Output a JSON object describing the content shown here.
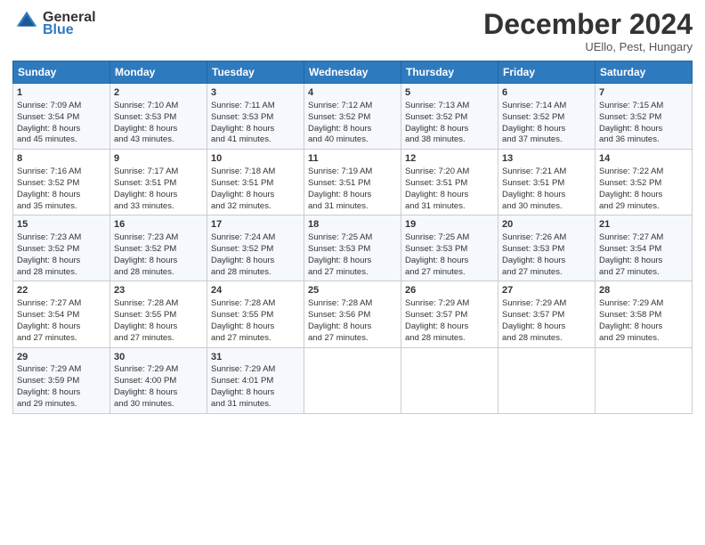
{
  "header": {
    "logo_line1": "General",
    "logo_line2": "Blue",
    "month": "December 2024",
    "location": "UEllo, Pest, Hungary"
  },
  "days_of_week": [
    "Sunday",
    "Monday",
    "Tuesday",
    "Wednesday",
    "Thursday",
    "Friday",
    "Saturday"
  ],
  "weeks": [
    [
      {
        "day": "1",
        "lines": [
          "Sunrise: 7:09 AM",
          "Sunset: 3:54 PM",
          "Daylight: 8 hours",
          "and 45 minutes."
        ]
      },
      {
        "day": "2",
        "lines": [
          "Sunrise: 7:10 AM",
          "Sunset: 3:53 PM",
          "Daylight: 8 hours",
          "and 43 minutes."
        ]
      },
      {
        "day": "3",
        "lines": [
          "Sunrise: 7:11 AM",
          "Sunset: 3:53 PM",
          "Daylight: 8 hours",
          "and 41 minutes."
        ]
      },
      {
        "day": "4",
        "lines": [
          "Sunrise: 7:12 AM",
          "Sunset: 3:52 PM",
          "Daylight: 8 hours",
          "and 40 minutes."
        ]
      },
      {
        "day": "5",
        "lines": [
          "Sunrise: 7:13 AM",
          "Sunset: 3:52 PM",
          "Daylight: 8 hours",
          "and 38 minutes."
        ]
      },
      {
        "day": "6",
        "lines": [
          "Sunrise: 7:14 AM",
          "Sunset: 3:52 PM",
          "Daylight: 8 hours",
          "and 37 minutes."
        ]
      },
      {
        "day": "7",
        "lines": [
          "Sunrise: 7:15 AM",
          "Sunset: 3:52 PM",
          "Daylight: 8 hours",
          "and 36 minutes."
        ]
      }
    ],
    [
      {
        "day": "8",
        "lines": [
          "Sunrise: 7:16 AM",
          "Sunset: 3:52 PM",
          "Daylight: 8 hours",
          "and 35 minutes."
        ]
      },
      {
        "day": "9",
        "lines": [
          "Sunrise: 7:17 AM",
          "Sunset: 3:51 PM",
          "Daylight: 8 hours",
          "and 33 minutes."
        ]
      },
      {
        "day": "10",
        "lines": [
          "Sunrise: 7:18 AM",
          "Sunset: 3:51 PM",
          "Daylight: 8 hours",
          "and 32 minutes."
        ]
      },
      {
        "day": "11",
        "lines": [
          "Sunrise: 7:19 AM",
          "Sunset: 3:51 PM",
          "Daylight: 8 hours",
          "and 31 minutes."
        ]
      },
      {
        "day": "12",
        "lines": [
          "Sunrise: 7:20 AM",
          "Sunset: 3:51 PM",
          "Daylight: 8 hours",
          "and 31 minutes."
        ]
      },
      {
        "day": "13",
        "lines": [
          "Sunrise: 7:21 AM",
          "Sunset: 3:51 PM",
          "Daylight: 8 hours",
          "and 30 minutes."
        ]
      },
      {
        "day": "14",
        "lines": [
          "Sunrise: 7:22 AM",
          "Sunset: 3:52 PM",
          "Daylight: 8 hours",
          "and 29 minutes."
        ]
      }
    ],
    [
      {
        "day": "15",
        "lines": [
          "Sunrise: 7:23 AM",
          "Sunset: 3:52 PM",
          "Daylight: 8 hours",
          "and 28 minutes."
        ]
      },
      {
        "day": "16",
        "lines": [
          "Sunrise: 7:23 AM",
          "Sunset: 3:52 PM",
          "Daylight: 8 hours",
          "and 28 minutes."
        ]
      },
      {
        "day": "17",
        "lines": [
          "Sunrise: 7:24 AM",
          "Sunset: 3:52 PM",
          "Daylight: 8 hours",
          "and 28 minutes."
        ]
      },
      {
        "day": "18",
        "lines": [
          "Sunrise: 7:25 AM",
          "Sunset: 3:53 PM",
          "Daylight: 8 hours",
          "and 27 minutes."
        ]
      },
      {
        "day": "19",
        "lines": [
          "Sunrise: 7:25 AM",
          "Sunset: 3:53 PM",
          "Daylight: 8 hours",
          "and 27 minutes."
        ]
      },
      {
        "day": "20",
        "lines": [
          "Sunrise: 7:26 AM",
          "Sunset: 3:53 PM",
          "Daylight: 8 hours",
          "and 27 minutes."
        ]
      },
      {
        "day": "21",
        "lines": [
          "Sunrise: 7:27 AM",
          "Sunset: 3:54 PM",
          "Daylight: 8 hours",
          "and 27 minutes."
        ]
      }
    ],
    [
      {
        "day": "22",
        "lines": [
          "Sunrise: 7:27 AM",
          "Sunset: 3:54 PM",
          "Daylight: 8 hours",
          "and 27 minutes."
        ]
      },
      {
        "day": "23",
        "lines": [
          "Sunrise: 7:28 AM",
          "Sunset: 3:55 PM",
          "Daylight: 8 hours",
          "and 27 minutes."
        ]
      },
      {
        "day": "24",
        "lines": [
          "Sunrise: 7:28 AM",
          "Sunset: 3:55 PM",
          "Daylight: 8 hours",
          "and 27 minutes."
        ]
      },
      {
        "day": "25",
        "lines": [
          "Sunrise: 7:28 AM",
          "Sunset: 3:56 PM",
          "Daylight: 8 hours",
          "and 27 minutes."
        ]
      },
      {
        "day": "26",
        "lines": [
          "Sunrise: 7:29 AM",
          "Sunset: 3:57 PM",
          "Daylight: 8 hours",
          "and 28 minutes."
        ]
      },
      {
        "day": "27",
        "lines": [
          "Sunrise: 7:29 AM",
          "Sunset: 3:57 PM",
          "Daylight: 8 hours",
          "and 28 minutes."
        ]
      },
      {
        "day": "28",
        "lines": [
          "Sunrise: 7:29 AM",
          "Sunset: 3:58 PM",
          "Daylight: 8 hours",
          "and 29 minutes."
        ]
      }
    ],
    [
      {
        "day": "29",
        "lines": [
          "Sunrise: 7:29 AM",
          "Sunset: 3:59 PM",
          "Daylight: 8 hours",
          "and 29 minutes."
        ]
      },
      {
        "day": "30",
        "lines": [
          "Sunrise: 7:29 AM",
          "Sunset: 4:00 PM",
          "Daylight: 8 hours",
          "and 30 minutes."
        ]
      },
      {
        "day": "31",
        "lines": [
          "Sunrise: 7:29 AM",
          "Sunset: 4:01 PM",
          "Daylight: 8 hours",
          "and 31 minutes."
        ]
      },
      {
        "day": "",
        "lines": []
      },
      {
        "day": "",
        "lines": []
      },
      {
        "day": "",
        "lines": []
      },
      {
        "day": "",
        "lines": []
      }
    ]
  ]
}
